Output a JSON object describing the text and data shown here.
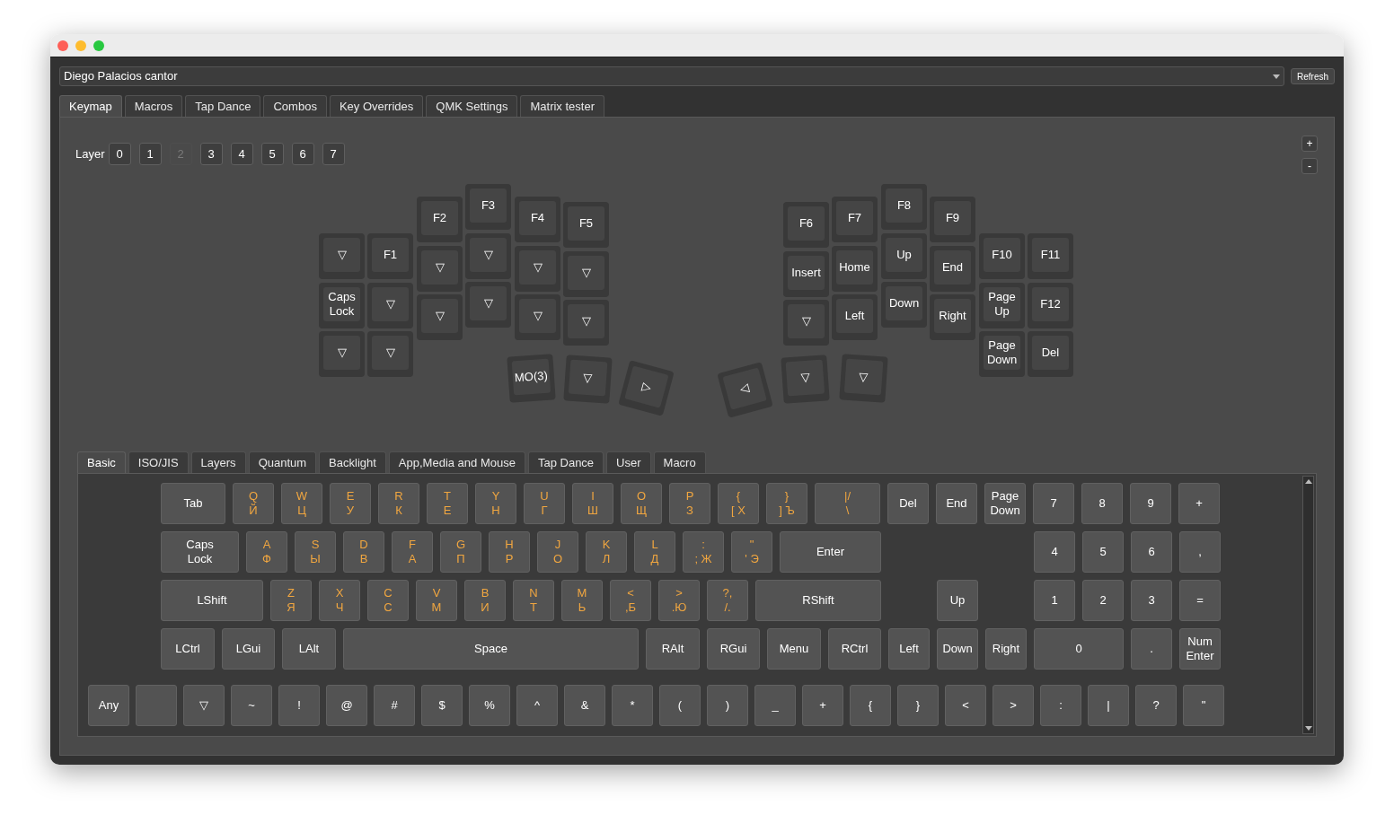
{
  "device_selector": {
    "value": "Diego Palacios cantor"
  },
  "refresh_button": "Refresh",
  "tabs": [
    {
      "label": "Keymap",
      "selected": true
    },
    {
      "label": "Macros",
      "selected": false
    },
    {
      "label": "Tap Dance",
      "selected": false
    },
    {
      "label": "Combos",
      "selected": false
    },
    {
      "label": "Key Overrides",
      "selected": false
    },
    {
      "label": "QMK Settings",
      "selected": false
    },
    {
      "label": "Matrix tester",
      "selected": false
    }
  ],
  "layer": {
    "label": "Layer",
    "buttons": [
      {
        "label": "0",
        "selected": false
      },
      {
        "label": "1",
        "selected": false
      },
      {
        "label": "2",
        "selected": true
      },
      {
        "label": "3",
        "selected": false
      },
      {
        "label": "4",
        "selected": false
      },
      {
        "label": "5",
        "selected": false
      },
      {
        "label": "6",
        "selected": false
      },
      {
        "label": "7",
        "selected": false
      }
    ]
  },
  "zoom_buttons": [
    "+",
    "-"
  ],
  "split_keyboard": {
    "left": {
      "columns": [
        [
          "▽",
          "Caps\nLock",
          "▽"
        ],
        [
          "F1",
          "▽",
          "▽"
        ],
        [
          "F2",
          "▽",
          "▽"
        ],
        [
          "F3",
          "▽",
          "▽"
        ],
        [
          "F4",
          "▽",
          "▽"
        ],
        [
          "F5",
          "▽",
          "▽"
        ]
      ],
      "thumbs": [
        "MO(3)",
        "▽",
        "▷"
      ]
    },
    "right": {
      "columns": [
        [
          "F6",
          "Insert",
          "▽"
        ],
        [
          "F7",
          "Home",
          "Left"
        ],
        [
          "F8",
          "Up",
          "Down"
        ],
        [
          "F9",
          "End",
          "Right"
        ],
        [
          "F10",
          "Page\nUp",
          "Page\nDown"
        ],
        [
          "F11",
          "F12",
          "Del"
        ]
      ],
      "thumbs": [
        "◁",
        "▽",
        "▽"
      ]
    }
  },
  "keycode_tabs": [
    {
      "label": "Basic",
      "selected": true
    },
    {
      "label": "ISO/JIS",
      "selected": false
    },
    {
      "label": "Layers",
      "selected": false
    },
    {
      "label": "Quantum",
      "selected": false
    },
    {
      "label": "Backlight",
      "selected": false
    },
    {
      "label": "App,Media and Mouse",
      "selected": false
    },
    {
      "label": "Tap Dance",
      "selected": false
    },
    {
      "label": "User",
      "selected": false
    },
    {
      "label": "Macro",
      "selected": false
    }
  ],
  "keycode_rows": [
    [
      {
        "kind": "normal",
        "label": "Tab"
      },
      {
        "kind": "letter",
        "label": "Q\nЙ"
      },
      {
        "kind": "letter",
        "label": "W\nЦ"
      },
      {
        "kind": "letter",
        "label": "E\nУ"
      },
      {
        "kind": "letter",
        "label": "R\nК"
      },
      {
        "kind": "letter",
        "label": "T\nЕ"
      },
      {
        "kind": "letter",
        "label": "Y\nН"
      },
      {
        "kind": "letter",
        "label": "U\nГ"
      },
      {
        "kind": "letter",
        "label": "I\nШ"
      },
      {
        "kind": "letter",
        "label": "O\nЩ"
      },
      {
        "kind": "letter",
        "label": "P\nЗ"
      },
      {
        "kind": "letter",
        "label": "{\n[ Х"
      },
      {
        "kind": "letter",
        "label": "}\n] Ъ"
      },
      {
        "kind": "letter",
        "label": "|/\n\\"
      },
      {
        "kind": "normal",
        "label": "Del"
      },
      {
        "kind": "normal",
        "label": "End"
      },
      {
        "kind": "normal",
        "label": "Page\nDown"
      },
      {
        "kind": "normal",
        "label": "7"
      },
      {
        "kind": "normal",
        "label": "8"
      },
      {
        "kind": "normal",
        "label": "9"
      },
      {
        "kind": "normal",
        "label": "+"
      }
    ],
    [
      {
        "kind": "normal",
        "label": "Caps\nLock"
      },
      {
        "kind": "letter",
        "label": "A\nФ"
      },
      {
        "kind": "letter",
        "label": "S\nЫ"
      },
      {
        "kind": "letter",
        "label": "D\nВ"
      },
      {
        "kind": "letter",
        "label": "F\nА"
      },
      {
        "kind": "letter",
        "label": "G\nП"
      },
      {
        "kind": "letter",
        "label": "H\nР"
      },
      {
        "kind": "letter",
        "label": "J\nО"
      },
      {
        "kind": "letter",
        "label": "K\nЛ"
      },
      {
        "kind": "letter",
        "label": "L\nД"
      },
      {
        "kind": "letter",
        "label": ":\n; Ж"
      },
      {
        "kind": "letter",
        "label": "\"\n' Э"
      },
      {
        "kind": "normal",
        "label": "Enter"
      },
      {
        "kind": "normal",
        "label": "4"
      },
      {
        "kind": "normal",
        "label": "5"
      },
      {
        "kind": "normal",
        "label": "6"
      },
      {
        "kind": "normal",
        "label": ","
      }
    ],
    [
      {
        "kind": "normal",
        "label": "LShift"
      },
      {
        "kind": "letter",
        "label": "Z\nЯ"
      },
      {
        "kind": "letter",
        "label": "X\nЧ"
      },
      {
        "kind": "letter",
        "label": "C\nС"
      },
      {
        "kind": "letter",
        "label": "V\nМ"
      },
      {
        "kind": "letter",
        "label": "B\nИ"
      },
      {
        "kind": "letter",
        "label": "N\nТ"
      },
      {
        "kind": "letter",
        "label": "M\nЬ"
      },
      {
        "kind": "letter",
        "label": "<\n,Б"
      },
      {
        "kind": "letter",
        "label": ">\n.Ю"
      },
      {
        "kind": "letter",
        "label": "?,\n/."
      },
      {
        "kind": "normal",
        "label": "RShift"
      },
      {
        "kind": "normal",
        "label": "Up"
      },
      {
        "kind": "normal",
        "label": "1"
      },
      {
        "kind": "normal",
        "label": "2"
      },
      {
        "kind": "normal",
        "label": "3"
      },
      {
        "kind": "normal",
        "label": "="
      }
    ],
    [
      {
        "kind": "normal",
        "label": "LCtrl"
      },
      {
        "kind": "normal",
        "label": "LGui"
      },
      {
        "kind": "normal",
        "label": "LAlt"
      },
      {
        "kind": "normal",
        "label": "Space"
      },
      {
        "kind": "normal",
        "label": "RAlt"
      },
      {
        "kind": "normal",
        "label": "RGui"
      },
      {
        "kind": "normal",
        "label": "Menu"
      },
      {
        "kind": "normal",
        "label": "RCtrl"
      },
      {
        "kind": "normal",
        "label": "Left"
      },
      {
        "kind": "normal",
        "label": "Down"
      },
      {
        "kind": "normal",
        "label": "Right"
      },
      {
        "kind": "normal",
        "label": "0"
      },
      {
        "kind": "normal",
        "label": "."
      },
      {
        "kind": "normal",
        "label": "Num\nEnter"
      }
    ]
  ],
  "symbol_row": [
    {
      "kind": "normal",
      "label": "Any"
    },
    {
      "kind": "blank"
    },
    {
      "kind": "normal",
      "label": "▽"
    },
    {
      "kind": "normal",
      "label": "~"
    },
    {
      "kind": "normal",
      "label": "!"
    },
    {
      "kind": "normal",
      "label": "@"
    },
    {
      "kind": "normal",
      "label": "#"
    },
    {
      "kind": "normal",
      "label": "$"
    },
    {
      "kind": "normal",
      "label": "%"
    },
    {
      "kind": "normal",
      "label": "^"
    },
    {
      "kind": "normal",
      "label": "&"
    },
    {
      "kind": "normal",
      "label": "*"
    },
    {
      "kind": "normal",
      "label": "("
    },
    {
      "kind": "normal",
      "label": ")"
    },
    {
      "kind": "normal",
      "label": "_"
    },
    {
      "kind": "normal",
      "label": "+"
    },
    {
      "kind": "normal",
      "label": "{"
    },
    {
      "kind": "normal",
      "label": "}"
    },
    {
      "kind": "normal",
      "label": "<"
    },
    {
      "kind": "normal",
      "label": ">"
    },
    {
      "kind": "normal",
      "label": ":"
    },
    {
      "kind": "normal",
      "label": "|"
    },
    {
      "kind": "normal",
      "label": "?"
    },
    {
      "kind": "normal",
      "label": "\""
    }
  ]
}
